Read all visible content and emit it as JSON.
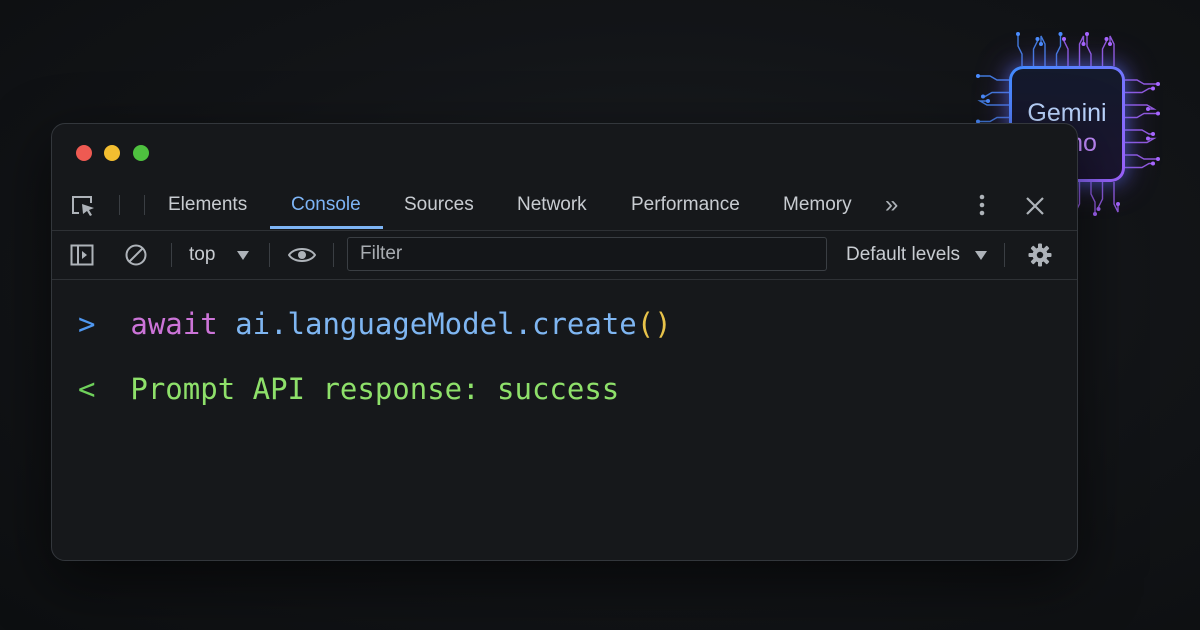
{
  "window": {
    "traffic_lights": [
      "close",
      "minimize",
      "maximize"
    ]
  },
  "tabs": [
    {
      "label": "Elements",
      "active": false
    },
    {
      "label": "Console",
      "active": true
    },
    {
      "label": "Sources",
      "active": false
    },
    {
      "label": "Network",
      "active": false
    },
    {
      "label": "Performance",
      "active": false
    },
    {
      "label": "Memory",
      "active": false
    }
  ],
  "tabbar": {
    "more_tabs_glyph": "»",
    "icons": [
      "inspect-element-icon",
      "more-tabs-icon",
      "kebab-menu-icon",
      "close-icon"
    ]
  },
  "toolbar": {
    "context": "top",
    "filter_placeholder": "Filter",
    "levels": "Default levels",
    "icons": [
      "sidebar-toggle-icon",
      "clear-console-icon",
      "eye-icon",
      "gear-icon"
    ]
  },
  "console": {
    "input": {
      "prompt": ">",
      "keyword": "await",
      "expression": "ai.languageModel.create",
      "parens": "()"
    },
    "output": {
      "prompt": "<",
      "text": "Prompt API response: success"
    }
  },
  "badge": {
    "line1": "Gemini",
    "line2": "Nano"
  },
  "colors": {
    "accent": "#7db4f5",
    "keyword": "#cc74d8",
    "result": "#8ee06a",
    "paren": "#e8c34a"
  }
}
